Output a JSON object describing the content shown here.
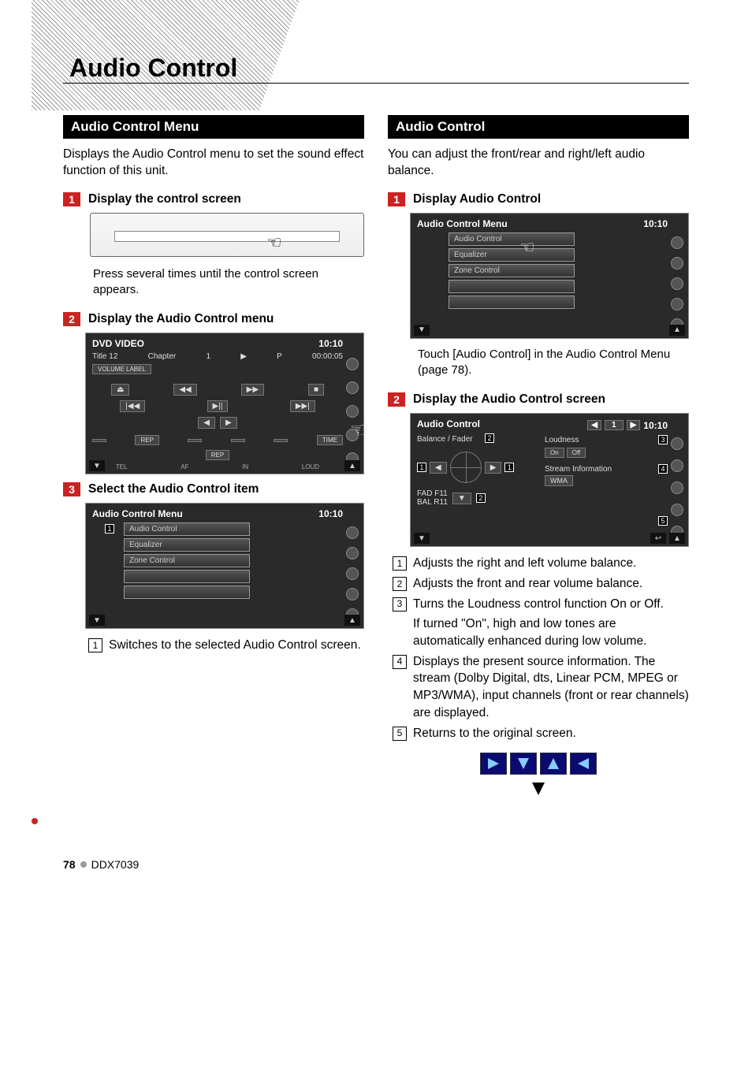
{
  "page_title": "Audio Control",
  "left_column": {
    "section_title": "Audio Control Menu",
    "intro": "Displays the Audio Control menu to set the sound effect function of this unit.",
    "steps": [
      {
        "num": "1",
        "label": "Display the control screen",
        "caption": "Press several times until the control screen appears."
      },
      {
        "num": "2",
        "label": "Display the Audio Control menu",
        "screen": {
          "title": "DVD VIDEO",
          "clock": "10:10",
          "info_line": {
            "title": "Title 12",
            "chapter": "Chapter",
            "chnum": "1",
            "play": "▶",
            "p": "P",
            "time": "00:00:05"
          },
          "vol_label": "VOLUME LABEL",
          "buttons_row1": [
            "⏏",
            "◀◀",
            "▶▶",
            "■"
          ],
          "buttons_row2": [
            "|◀◀",
            "▶||",
            "▶▶|"
          ],
          "buttons_row3": [
            "◀",
            "▶"
          ],
          "rep1": "REP",
          "rep2": "REP",
          "time_btn": "TIME",
          "bottom_labels": [
            "TEL",
            "AF",
            "IN",
            "LOUD"
          ]
        }
      },
      {
        "num": "3",
        "label": "Select the Audio Control item",
        "screen": {
          "title": "Audio Control Menu",
          "clock": "10:10",
          "items": [
            "Audio Control",
            "Equalizer",
            "Zone Control",
            "",
            ""
          ],
          "annot": "1"
        }
      }
    ],
    "callouts": [
      {
        "n": "1",
        "text": "Switches to the selected Audio Control screen."
      }
    ]
  },
  "right_column": {
    "section_title": "Audio Control",
    "intro": "You can adjust the front/rear and right/left audio balance.",
    "steps": [
      {
        "num": "1",
        "label": "Display Audio Control",
        "screen": {
          "title": "Audio Control Menu",
          "clock": "10:10",
          "items": [
            "Audio Control",
            "Equalizer",
            "Zone Control",
            "",
            ""
          ]
        },
        "caption": "Touch [Audio Control] in the Audio Control Menu (page 78)."
      },
      {
        "num": "2",
        "label": "Display the Audio Control screen",
        "screen": {
          "title": "Audio Control",
          "clock": "10:10",
          "balfad": "Balance / Fader",
          "loudness_label": "Loudness",
          "loud_on": "On",
          "loud_off": "Off",
          "stream_label": "Stream Information",
          "stream_value": "WMA",
          "fad": "FAD F11",
          "bal": "BAL R11",
          "annots": [
            "1",
            "2",
            "3",
            "4",
            "5"
          ],
          "tabs": [
            "◀",
            "1",
            "▶"
          ]
        }
      }
    ],
    "callouts": [
      {
        "n": "1",
        "text": "Adjusts the right and left volume balance."
      },
      {
        "n": "2",
        "text": "Adjusts the front and rear volume balance."
      },
      {
        "n": "3",
        "text": "Turns the Loudness control function On or Off."
      },
      {
        "n": "3b",
        "text": "If turned \"On\", high and low tones are automatically enhanced during low volume."
      },
      {
        "n": "4",
        "text": "Displays the present source information. The stream (Dolby Digital, dts, Linear PCM, MPEG or MP3/WMA), input channels (front or  rear channels) are displayed."
      },
      {
        "n": "5",
        "text": "Returns to the original screen."
      }
    ]
  },
  "footer": {
    "page": "78",
    "model": "DDX7039"
  }
}
